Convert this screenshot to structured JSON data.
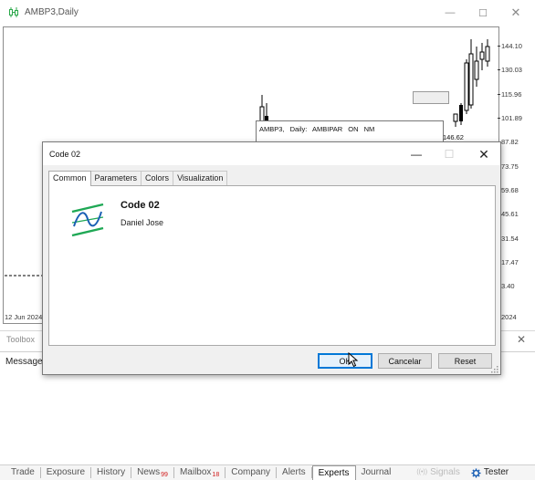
{
  "chart_window": {
    "title": "AMBP3,Daily",
    "price_labels": [
      "144.10",
      "130.03",
      "115.96",
      "101.89",
      "87.82",
      "73.75",
      "59.68",
      "45.61",
      "31.54",
      "17.47",
      "3.40"
    ],
    "date_left": "12 Jun 2024",
    "date_right": "2024",
    "indicator_text": "AMBP3, Daily: AMBIPAR  ON  NM",
    "indicator_price": "146.62"
  },
  "toolbox": {
    "title": "Toolbox",
    "column_message": "Message",
    "tabs": [
      {
        "label": "Trade",
        "badge": ""
      },
      {
        "label": "Exposure",
        "badge": ""
      },
      {
        "label": "History",
        "badge": ""
      },
      {
        "label": "News",
        "badge": "99"
      },
      {
        "label": "Mailbox",
        "badge": "18"
      },
      {
        "label": "Company",
        "badge": ""
      },
      {
        "label": "Alerts",
        "badge": ""
      },
      {
        "label": "Experts",
        "badge": ""
      },
      {
        "label": "Journal",
        "badge": ""
      }
    ],
    "active_tab": "Experts",
    "signals_label": "Signals",
    "tester_label": "Tester"
  },
  "dialog": {
    "title": "Code 02",
    "tabs": [
      "Common",
      "Parameters",
      "Colors",
      "Visualization"
    ],
    "active_tab": "Common",
    "indicator_name": "Code 02",
    "author": "Daniel Jose",
    "buttons": {
      "ok": "OK",
      "cancel": "Cancelar",
      "reset": "Reset"
    }
  },
  "colors": {
    "logo_green": "#1fa855",
    "logo_blue": "#1a5fb4",
    "badge_red": "#d01818",
    "default_button_border": "#0078d7"
  }
}
